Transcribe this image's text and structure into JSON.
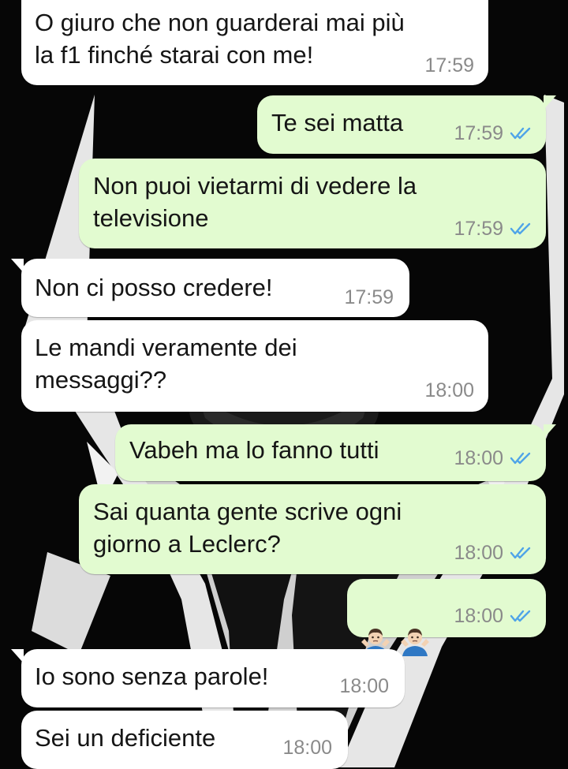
{
  "colors": {
    "incoming_bubble": "#ffffff",
    "outgoing_bubble": "#e2fbd0",
    "read_ticks": "#4fa4e8",
    "timestamp": "#8a8a8a",
    "wallpaper": "#070707"
  },
  "messages": [
    {
      "direction": "in",
      "text": "O giuro che non guarderai mai più\nla f1 finché starai con me!",
      "time": "17:59"
    },
    {
      "direction": "out",
      "text": "Te sei matta",
      "time": "17:59",
      "status": "read"
    },
    {
      "direction": "out",
      "text": "Non puoi vietarmi di vedere la\ntelevisione",
      "time": "17:59",
      "status": "read"
    },
    {
      "direction": "in",
      "text": "Non ci posso credere!",
      "time": "17:59"
    },
    {
      "direction": "in",
      "text": "Le mandi veramente dei\nmessaggi??",
      "time": "18:00"
    },
    {
      "direction": "out",
      "text": "Vabeh ma lo fanno tutti",
      "time": "18:00",
      "status": "read"
    },
    {
      "direction": "out",
      "text": "Sai quanta gente scrive ogni\ngiorno a Leclerc?",
      "time": "18:00",
      "status": "read"
    },
    {
      "direction": "out",
      "emoji": [
        "man-shrugging-emoji",
        "man-shrugging-emoji"
      ],
      "time": "18:00",
      "status": "read"
    },
    {
      "direction": "in",
      "text": "Io sono senza parole!",
      "time": "18:00"
    },
    {
      "direction": "in",
      "text": "Sei un deficiente",
      "time": "18:00"
    }
  ]
}
